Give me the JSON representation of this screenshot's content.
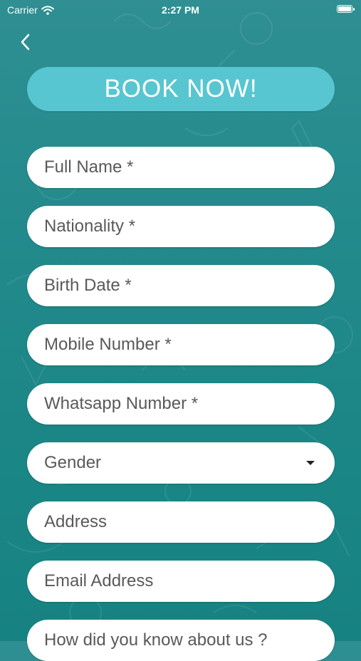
{
  "status_bar": {
    "carrier": "Carrier",
    "time": "2:27 PM"
  },
  "header": {
    "back_icon": "chevron-left-icon",
    "book_now_label": "BOOK NOW!"
  },
  "form": {
    "full_name": "Full Name *",
    "nationality": "Nationality *",
    "birth_date": "Birth Date *",
    "mobile_number": "Mobile Number *",
    "whatsapp_number": "Whatsapp Number *",
    "gender": "Gender",
    "address": "Address",
    "email_address": "Email Address",
    "how_did_you_know": "How did you know about us ?"
  },
  "colors": {
    "background": "#238a8c",
    "book_button": "#57c6d0",
    "field_background": "#ffffff",
    "placeholder_text": "#595959"
  }
}
